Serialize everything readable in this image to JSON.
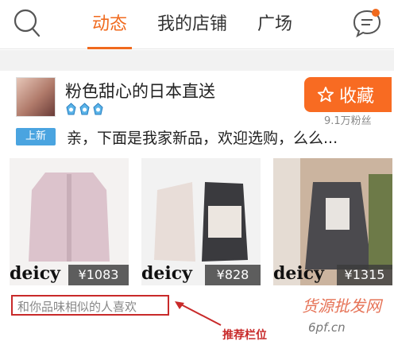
{
  "tabs": [
    {
      "label": "动态",
      "active": true
    },
    {
      "label": "我的店铺",
      "active": false
    },
    {
      "label": "广场",
      "active": false
    }
  ],
  "accent_color": "#f06a1e",
  "shop": {
    "name": "粉色甜心的日本直送",
    "level_icon": "crown-icon",
    "level_count": 3,
    "favorite_label": "收藏",
    "fans": "9.1万粉丝"
  },
  "post": {
    "badge": "上新",
    "text": "亲，下面是我家新品，欢迎选购，么么..."
  },
  "products": [
    {
      "brand": "deicy",
      "price": "¥1083"
    },
    {
      "brand": "deicy",
      "price": "¥828"
    },
    {
      "brand": "deicy",
      "price": "¥1315"
    }
  ],
  "recommend": {
    "text": "和你品味相似的人喜欢",
    "annotation": "推荐栏位"
  },
  "watermark": {
    "title": "货源批发网",
    "url": "6pf.cn"
  }
}
